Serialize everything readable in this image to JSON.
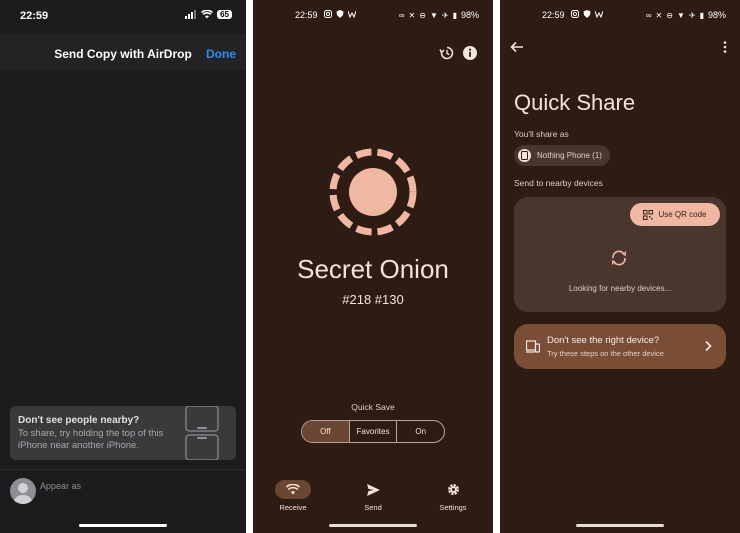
{
  "ios": {
    "status": {
      "time": "22:59",
      "battery": "65"
    },
    "sheet_title": "Send Copy with AirDrop",
    "done_label": "Done",
    "tip_title": "Don't see people nearby?",
    "tip_body": "To share, try holding the top of this iPhone near another iPhone.",
    "appear_as": "Appear as"
  },
  "receive": {
    "status": {
      "time": "22:59",
      "battery": "98%"
    },
    "device_name": "Secret Onion",
    "device_code": "#218 #130",
    "quick_save_label": "Quick Save",
    "quick_save_options": [
      "Off",
      "Favorites",
      "On"
    ],
    "quick_save_selected": "Off",
    "nav": [
      {
        "label": "Receive",
        "icon": "wifi-icon",
        "active": true
      },
      {
        "label": "Send",
        "icon": "send-icon",
        "active": false
      },
      {
        "label": "Settings",
        "icon": "gear-icon",
        "active": false
      }
    ],
    "colors": {
      "accent": "#f0b8a3",
      "background": "#2e1c14"
    }
  },
  "quick_share": {
    "status": {
      "time": "22:59",
      "battery": "98%"
    },
    "title": "Quick Share",
    "share_as_label": "You'll share as",
    "device_chip": "Nothing Phone (1)",
    "nearby_label": "Send to nearby devices",
    "qr_button": "Use QR code",
    "looking_text": "Looking for nearby devices...",
    "help_title": "Don't see the right device?",
    "help_subtitle": "Try these steps on the other device"
  }
}
